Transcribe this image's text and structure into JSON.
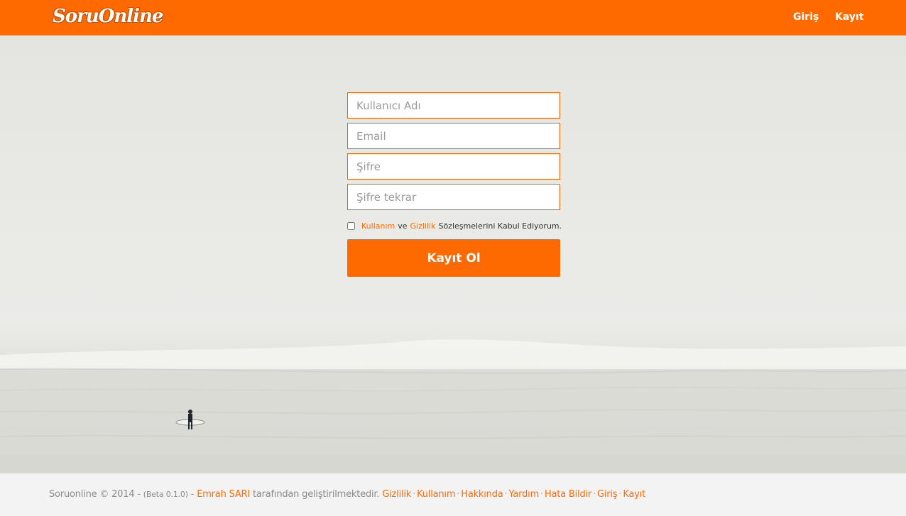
{
  "header": {
    "logo": "SoruOnline",
    "nav": {
      "login": "Giriş",
      "register": "Kayıt"
    }
  },
  "form": {
    "username_placeholder": "Kullanıcı Adı",
    "email_placeholder": "Email",
    "password_placeholder": "Şifre",
    "password_repeat_placeholder": "Şifre tekrar",
    "terms": {
      "usage_link": "Kullanım",
      "and": "ve",
      "privacy_link": "Gizlilik",
      "suffix": "Sözleşmelerini Kabul Ediyorum."
    },
    "submit_label": "Kayıt Ol"
  },
  "footer": {
    "brand": "Soruonline © 2014 -",
    "beta": "(Beta 0.1.0)",
    "dash": "-",
    "author": "Emrah SARI",
    "developed": "tarafından geliştirilmektedir.",
    "links": [
      "Gizlilik",
      "Kullanım",
      "Hakkında",
      "Yardım",
      "Hata Bildir",
      "Giriş",
      "Kayıt"
    ]
  },
  "colors": {
    "accent": "#ff6a00",
    "footer_bg": "#f3f3f3"
  }
}
